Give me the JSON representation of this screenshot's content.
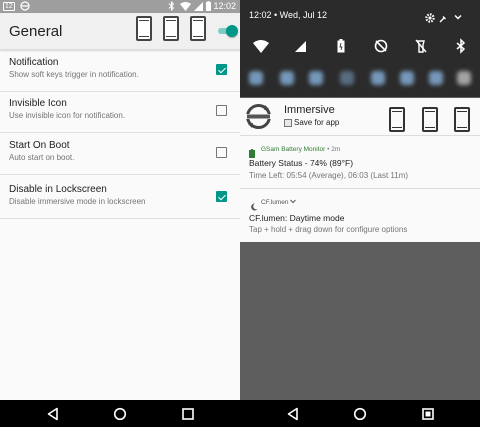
{
  "left": {
    "status_bar": {
      "time": "12:02",
      "notification_count": "12",
      "icons": [
        "notification-count-icon",
        "sync-icon",
        "bluetooth-icon",
        "wifi-icon",
        "signal-icon",
        "battery-icon"
      ]
    },
    "app_bar": {
      "title": "General",
      "icons": [
        "phone-mode-1-icon",
        "phone-mode-2-icon",
        "phone-mode-3-icon"
      ],
      "toggle_on": true
    },
    "prefs": [
      {
        "title": "Notification",
        "summary": "Show soft keys trigger in notification.",
        "checked": true
      },
      {
        "title": "Invisible Icon",
        "summary": "Use invisible icon for notification.",
        "checked": false
      },
      {
        "title": "Start On Boot",
        "summary": "Auto start on boot.",
        "checked": false
      },
      {
        "title": "Disable in Lockscreen",
        "summary": "Disable immersive mode in lockscreen",
        "checked": true
      }
    ]
  },
  "right": {
    "header": {
      "status_text": "12:02 • Wed, Jul 12",
      "icons": [
        "settings-gear-icon",
        "wrench-icon",
        "expand-chevron-icon"
      ]
    },
    "quick_settings": [
      "wifi-icon",
      "signal-icon",
      "battery-icon",
      "dnd-icon",
      "flashlight-icon",
      "bluetooth-icon"
    ],
    "immersive": {
      "title": "Immersive",
      "save_label": "Save for app"
    },
    "notifications": [
      {
        "app": "GSam Battery Monitor",
        "age": "2m",
        "title": "Battery Status - 74% (89°F)",
        "text": "Time Left: 05:54 (Average), 06:03 (Last 11m)"
      },
      {
        "app": "CF.lumen",
        "age": "",
        "title": "CF.lumen: Daytime mode",
        "text": "Tap + hold + drag down for configure options"
      }
    ]
  },
  "nav": {
    "buttons": [
      "back-icon",
      "home-icon",
      "recents-icon"
    ]
  },
  "colors": {
    "accent": "#009688",
    "gsam_green": "#2e7d32"
  }
}
